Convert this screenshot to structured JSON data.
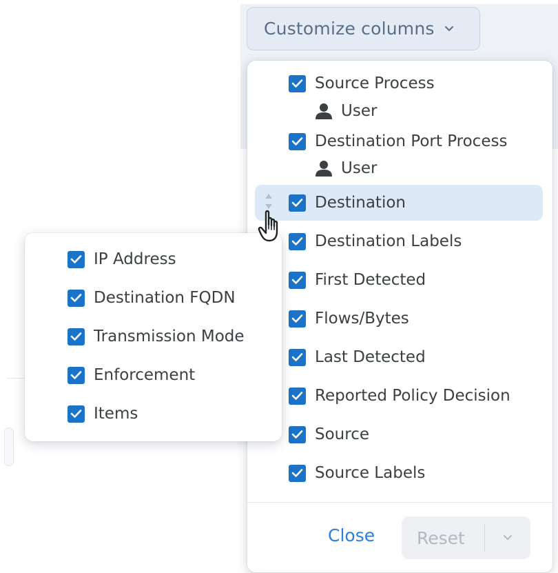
{
  "header": {
    "customize_label": "Customize columns"
  },
  "menu": {
    "items": [
      {
        "label": "Source Process",
        "checked": true,
        "sub_label": "User"
      },
      {
        "label": "Destination Port Process",
        "checked": true,
        "sub_label": "User"
      },
      {
        "label": "Destination",
        "checked": true,
        "dragging": true
      },
      {
        "label": "Destination Labels",
        "checked": true
      },
      {
        "label": "First Detected",
        "checked": true
      },
      {
        "label": "Flows/Bytes",
        "checked": true
      },
      {
        "label": "Last Detected",
        "checked": true
      },
      {
        "label": "Reported Policy Decision",
        "checked": true
      },
      {
        "label": "Source",
        "checked": true
      },
      {
        "label": "Source Labels",
        "checked": true
      }
    ],
    "close_label": "Close",
    "reset_label": "Reset"
  },
  "group_panel": {
    "items": [
      {
        "label": "IP Address",
        "checked": true
      },
      {
        "label": "Destination FQDN",
        "checked": true
      },
      {
        "label": "Transmission Mode",
        "checked": true
      },
      {
        "label": "Enforcement",
        "checked": true
      },
      {
        "label": "Items",
        "checked": true
      }
    ]
  },
  "colors": {
    "checkbox": "#1a73c7",
    "link": "#2b7de0",
    "highlight": "#dde9f7"
  },
  "icons": {
    "user": "user-icon",
    "chevron": "chevron-down-icon",
    "drag": "drag-handle-icon",
    "cursor": "hand-cursor-icon"
  }
}
